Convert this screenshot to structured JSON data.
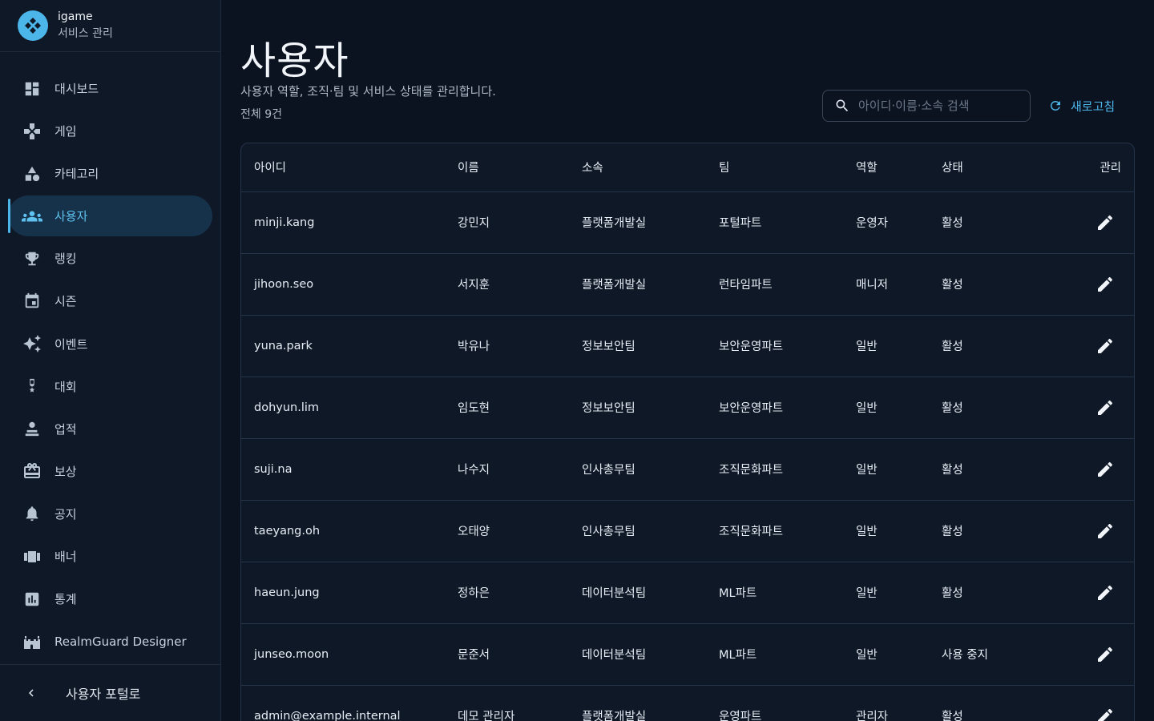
{
  "brand": {
    "name": "igame",
    "subtitle": "서비스 관리"
  },
  "nav": [
    {
      "label": "대시보드",
      "icon": "dashboard-icon",
      "active": false
    },
    {
      "label": "게임",
      "icon": "gamepad-icon",
      "active": false
    },
    {
      "label": "카테고리",
      "icon": "category-icon",
      "active": false
    },
    {
      "label": "사용자",
      "icon": "users-icon",
      "active": true
    },
    {
      "label": "랭킹",
      "icon": "trophy-icon",
      "active": false
    },
    {
      "label": "시즌",
      "icon": "calendar-icon",
      "active": false
    },
    {
      "label": "이벤트",
      "icon": "sparkle-icon",
      "active": false
    },
    {
      "label": "대회",
      "icon": "medal-icon",
      "active": false
    },
    {
      "label": "업적",
      "icon": "badge-icon",
      "active": false
    },
    {
      "label": "보상",
      "icon": "gift-icon",
      "active": false
    },
    {
      "label": "공지",
      "icon": "bell-icon",
      "active": false
    },
    {
      "label": "배너",
      "icon": "banner-icon",
      "active": false
    },
    {
      "label": "통계",
      "icon": "stats-icon",
      "active": false
    },
    {
      "label": "RealmGuard Designer",
      "icon": "castle-icon",
      "active": false
    }
  ],
  "footer": {
    "label": "사용자 포털로"
  },
  "page": {
    "title": "사용자",
    "description": "사용자 역할, 조직·팀 및 서비스 상태를 관리합니다.",
    "count": "전체 9건"
  },
  "search": {
    "placeholder": "아이디·이름·소속 검색",
    "value": ""
  },
  "refresh": {
    "label": "새로고침"
  },
  "table": {
    "columns": [
      "아이디",
      "이름",
      "소속",
      "팀",
      "역할",
      "상태",
      "관리"
    ],
    "rows": [
      [
        "minji.kang",
        "강민지",
        "플랫폼개발실",
        "포털파트",
        "운영자",
        "활성"
      ],
      [
        "jihoon.seo",
        "서지훈",
        "플랫폼개발실",
        "런타임파트",
        "매니저",
        "활성"
      ],
      [
        "yuna.park",
        "박유나",
        "정보보안팀",
        "보안운영파트",
        "일반",
        "활성"
      ],
      [
        "dohyun.lim",
        "임도현",
        "정보보안팀",
        "보안운영파트",
        "일반",
        "활성"
      ],
      [
        "suji.na",
        "나수지",
        "인사총무팀",
        "조직문화파트",
        "일반",
        "활성"
      ],
      [
        "taeyang.oh",
        "오태양",
        "인사총무팀",
        "조직문화파트",
        "일반",
        "활성"
      ],
      [
        "haeun.jung",
        "정하은",
        "데이터분석팀",
        "ML파트",
        "일반",
        "활성"
      ],
      [
        "junseo.moon",
        "문준서",
        "데이터분석팀",
        "ML파트",
        "일반",
        "사용 중지"
      ],
      [
        "admin@example.internal",
        "데모 관리자",
        "플랫폼개발실",
        "운영파트",
        "관리자",
        "활성"
      ]
    ]
  },
  "colors": {
    "accent": "#4cb6ea",
    "background": "#0b1220",
    "sidebar": "#0f1827",
    "border": "#26344a"
  }
}
